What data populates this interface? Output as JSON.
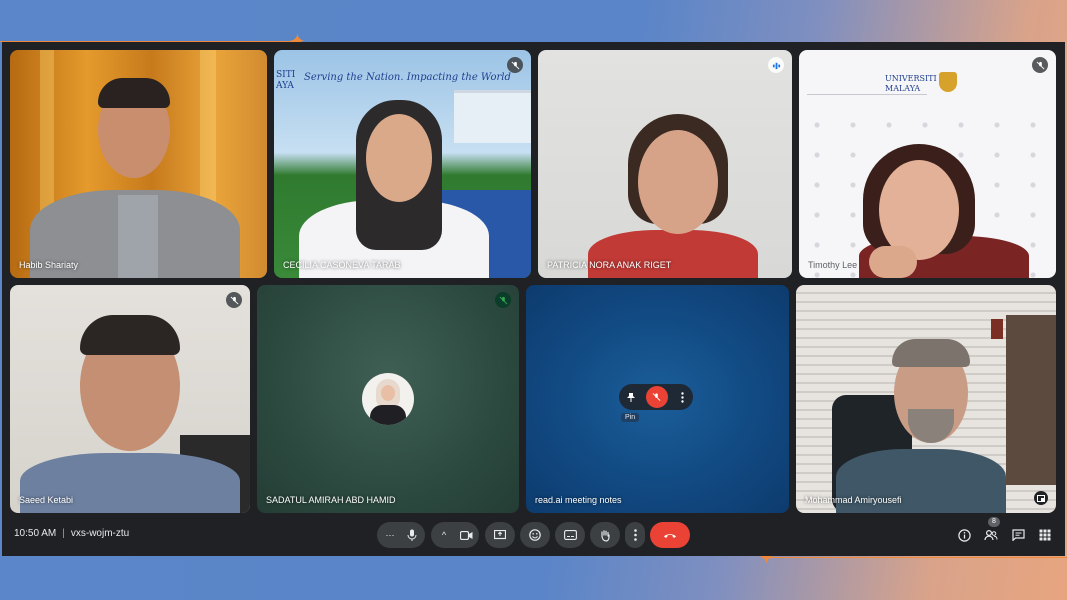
{
  "meeting": {
    "time": "10:50 AM",
    "code": "vxs-wojm-ztu",
    "participants_badge": "8"
  },
  "tiles": [
    {
      "name": "Habib Shariaty"
    },
    {
      "name": "CECILIA CASONEVA TARAB",
      "banner": "Serving the Nation. Impacting the World",
      "banner_prefix": "SITI\nAYA"
    },
    {
      "name": "PATRICIA NORA ANAK RIGET"
    },
    {
      "name": "Timothy Lee",
      "logo_text": "UNIVERSITI\nMALAYA"
    },
    {
      "name": "Saeed Ketabi"
    },
    {
      "name": "SADATUL AMIRAH ABD HAMID"
    },
    {
      "name": "read.ai meeting notes",
      "pin_tooltip": "Pin"
    },
    {
      "name": "Mohammad Amiryousefi"
    }
  ],
  "colors": {
    "accent_orange": "#f08a3a",
    "end_call_red": "#ea4335",
    "tile_bg": "#3c4043",
    "bar_bg": "#202124"
  },
  "icons": {
    "mic": "mic-icon",
    "camera": "camera-icon",
    "present": "present-icon",
    "emoji": "emoji-icon",
    "captions": "captions-icon",
    "hand": "raise-hand-icon",
    "more": "more-options-icon",
    "end": "end-call-icon",
    "info": "info-icon",
    "people": "people-icon",
    "chat": "chat-icon",
    "activities": "activities-icon"
  }
}
